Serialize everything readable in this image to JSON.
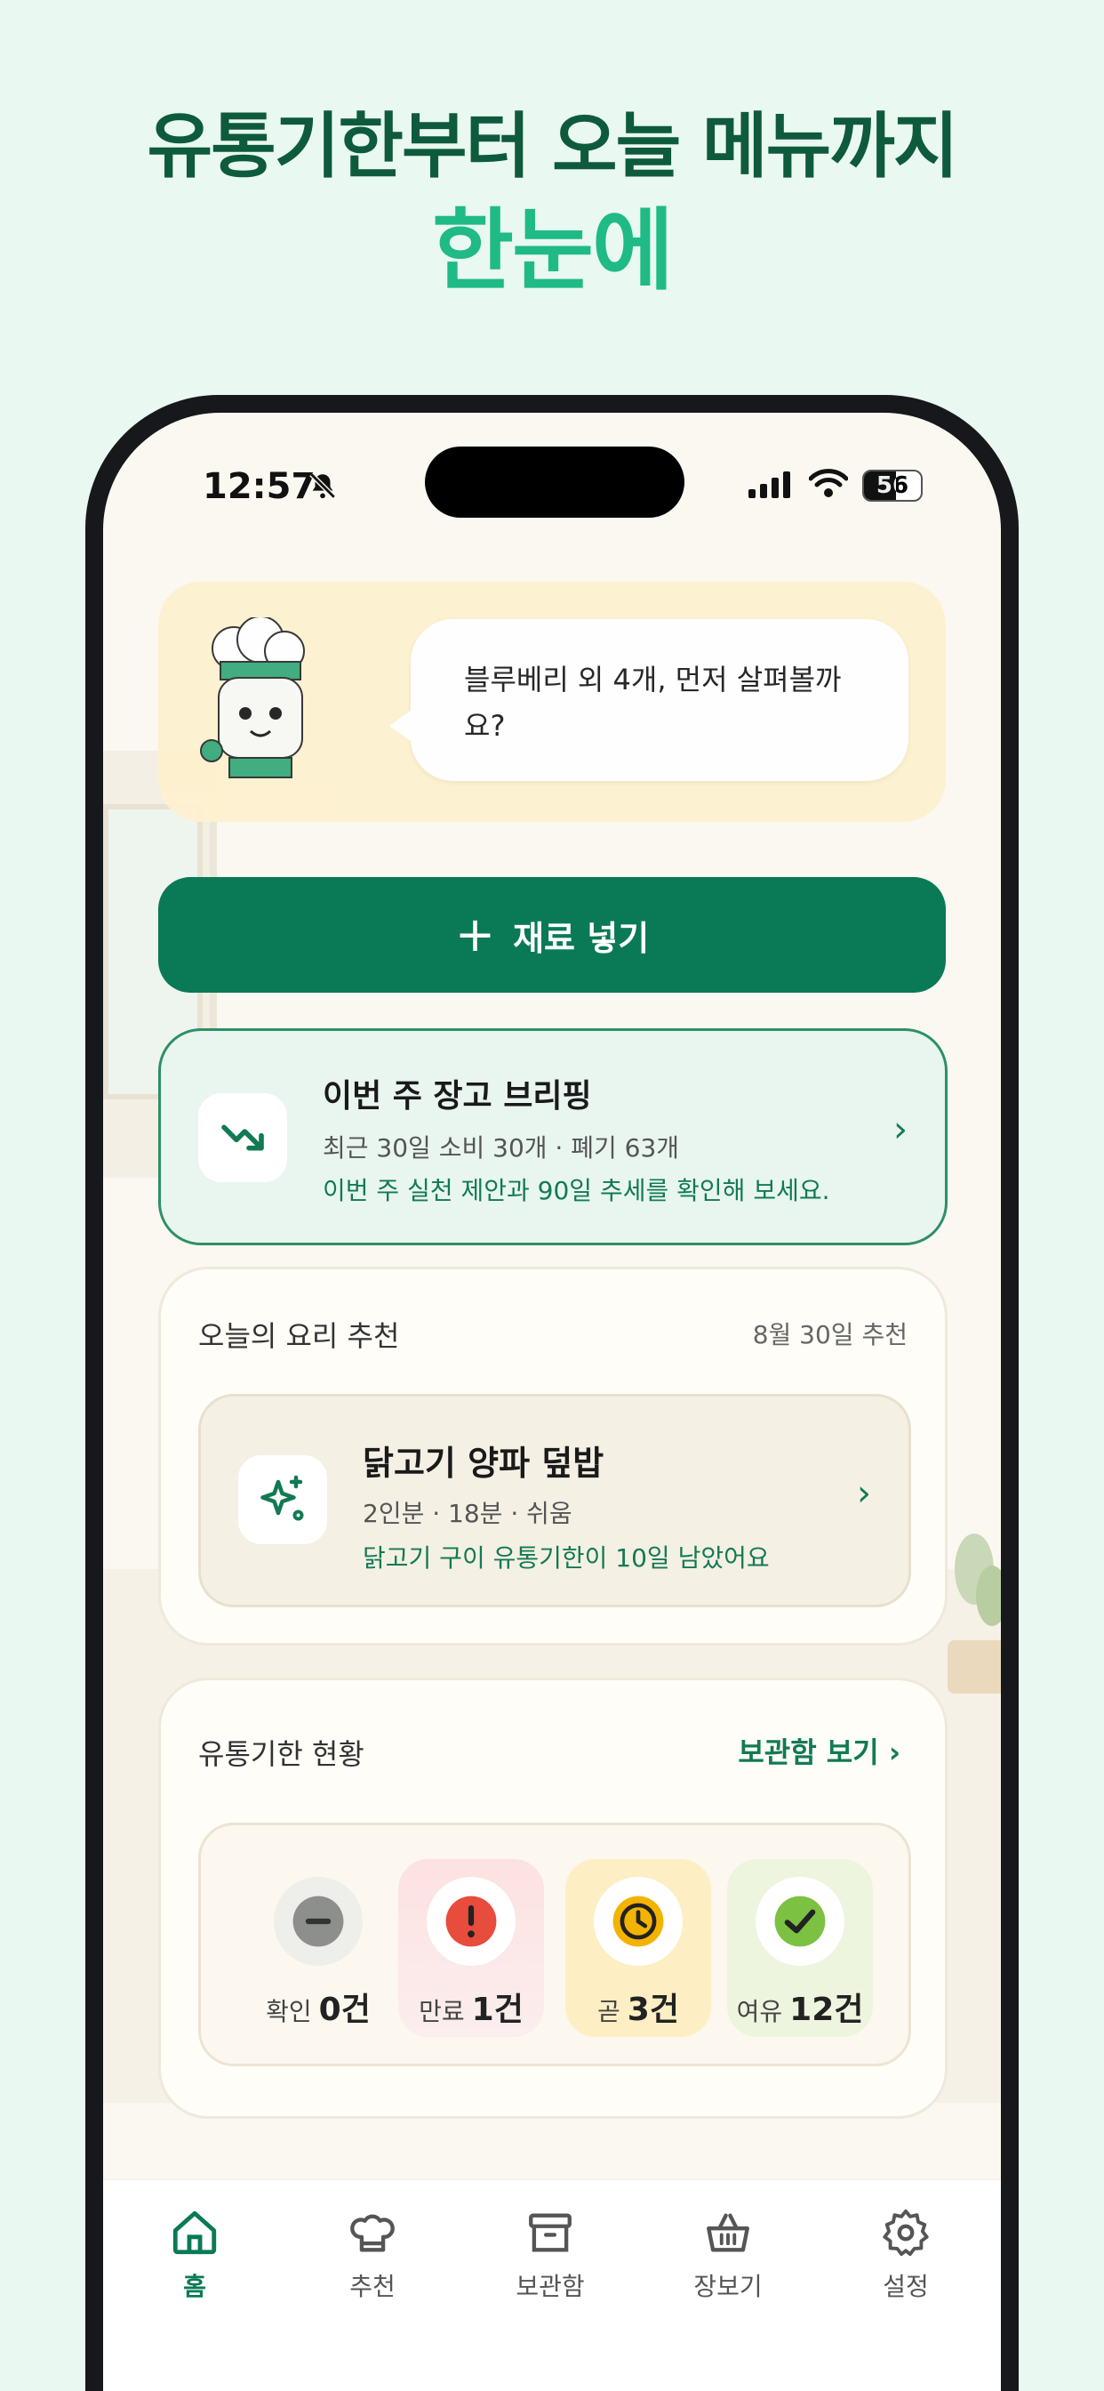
{
  "promo": {
    "line1": "유통기한부터 오늘 메뉴까지",
    "line2": "한눈에"
  },
  "status_bar": {
    "time": "12:57",
    "battery": "56",
    "battery_level": 0.56
  },
  "hero": {
    "message": "블루베리 외 4개, 먼저 살펴볼까요?"
  },
  "add_button": {
    "icon": "plus-icon",
    "label": "재료 넣기"
  },
  "briefing": {
    "icon": "trend-down-icon",
    "title": "이번 주 장고 브리핑",
    "summary": "최근 30일 소비 30개 · 폐기 63개",
    "hint": "이번 주 실천 제안과 90일 추세를 확인해 보세요."
  },
  "recommendation": {
    "section_title": "오늘의 요리 추천",
    "date": "8월 30일 추천",
    "icon": "sparkles-icon",
    "dish": "닭고기 양파 덮밥",
    "meta": "2인분 · 18분 · 쉬움",
    "hint": "닭고기 구이 유통기한이 10일 남았어요"
  },
  "expiry": {
    "section_title": "유통기한 현황",
    "link": "보관함 보기",
    "stats": [
      {
        "label": "확인",
        "value": "0건",
        "color": "#8d8f8c"
      },
      {
        "label": "만료",
        "value": "1건",
        "color": "#e74c3c"
      },
      {
        "label": "곧",
        "value": "3건",
        "color": "#f2b400"
      },
      {
        "label": "여유",
        "value": "12건",
        "color": "#7cc142"
      }
    ]
  },
  "colors": {
    "brand": "#0a7a56",
    "accent": "#1fba86",
    "headline": "#0e5a3d"
  },
  "tabbar": {
    "items": [
      {
        "label": "홈",
        "icon": "home-icon",
        "active": true
      },
      {
        "label": "추천",
        "icon": "chef-hat-icon",
        "active": false
      },
      {
        "label": "보관함",
        "icon": "archive-icon",
        "active": false
      },
      {
        "label": "장보기",
        "icon": "basket-icon",
        "active": false
      },
      {
        "label": "설정",
        "icon": "gear-icon",
        "active": false
      }
    ]
  }
}
